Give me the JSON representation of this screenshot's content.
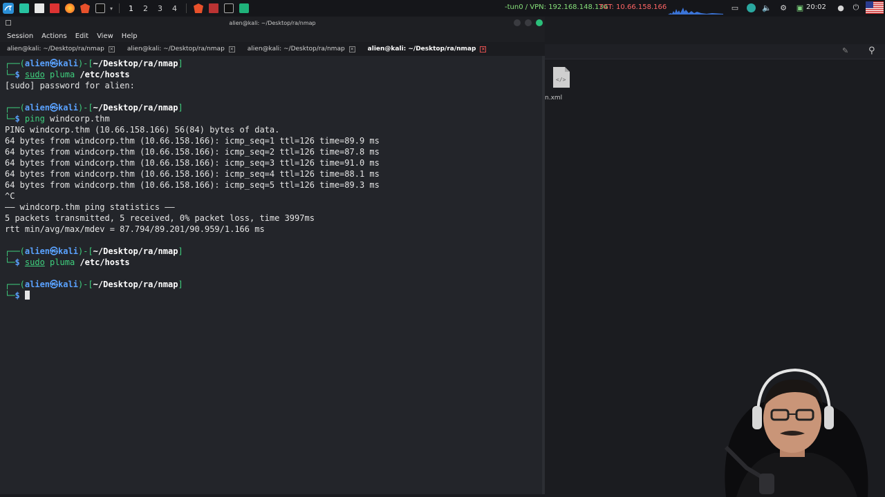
{
  "panel": {
    "workspaces": [
      "1",
      "2",
      "3",
      "4"
    ],
    "vpn_text": "-tun0 / VPN: 192.168.148.134",
    "target_text": "TGT: 10.66.158.166",
    "clock": "20:02"
  },
  "filemanager": {
    "file_label": "n.xml"
  },
  "terminal": {
    "window_title": "alien@kali: ~/Desktop/ra/nmap",
    "menu": [
      "Session",
      "Actions",
      "Edit",
      "View",
      "Help"
    ],
    "tabs": [
      "alien@kali: ~/Desktop/ra/nmap",
      "alien@kali: ~/Desktop/ra/nmap",
      "alien@kali: ~/Desktop/ra/nmap",
      "alien@kali: ~/Desktop/ra/nmap"
    ],
    "prompt": {
      "user": "alien",
      "at": "㉿",
      "host": "kali",
      "path": "~/Desktop/ra/nmap"
    },
    "commands": {
      "c1_sudo": "sudo",
      "c1_prog": "pluma",
      "c1_arg": "/etc/hosts",
      "c2_prog": "ping",
      "c2_arg": "windcorp.thm",
      "c3_sudo": "sudo",
      "c3_prog": "pluma",
      "c3_arg": "/etc/hosts"
    },
    "output": {
      "sudo_prompt": "[sudo] password for alien:",
      "ping_header": "PING windcorp.thm (10.66.158.166) 56(84) bytes of data.",
      "ping_lines": [
        "64 bytes from windcorp.thm (10.66.158.166): icmp_seq=1 ttl=126 time=89.9 ms",
        "64 bytes from windcorp.thm (10.66.158.166): icmp_seq=2 ttl=126 time=87.8 ms",
        "64 bytes from windcorp.thm (10.66.158.166): icmp_seq=3 ttl=126 time=91.0 ms",
        "64 bytes from windcorp.thm (10.66.158.166): icmp_seq=4 ttl=126 time=88.1 ms",
        "64 bytes from windcorp.thm (10.66.158.166): icmp_seq=5 ttl=126 time=89.3 ms"
      ],
      "interrupt": "^C",
      "stats_header": "—— windcorp.thm ping statistics ——",
      "stats_packets": "5 packets transmitted, 5 received, 0% packet loss, time 3997ms",
      "stats_rtt": "rtt min/avg/max/mdev = 87.794/89.201/90.959/1.166 ms"
    }
  },
  "colors": {
    "prompt_green": "#3fd07e",
    "prompt_blue": "#5aa2ff",
    "terminal_bg": "#23252a"
  }
}
